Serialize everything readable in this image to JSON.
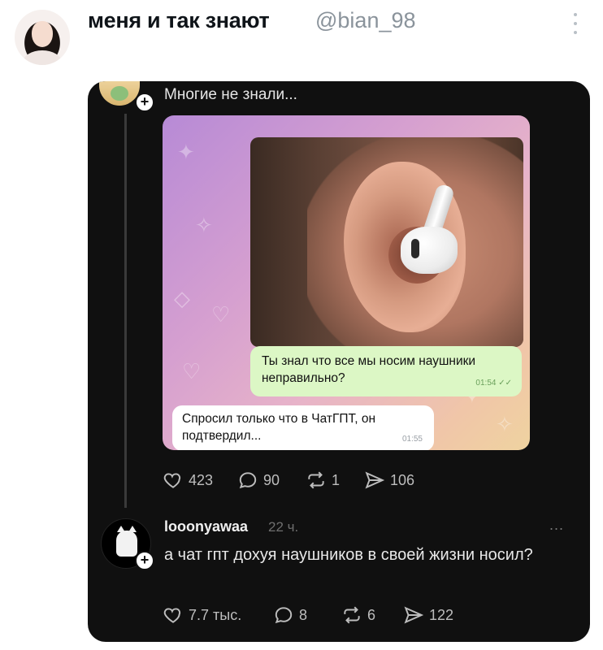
{
  "tweet": {
    "display_name": "меня и так знают",
    "handle": "@bian_98",
    "more_icon": "vertical-dots-icon"
  },
  "post": {
    "text": "Многие не знали...",
    "screenshot": {
      "message_out": "Ты знал что все мы носим наушники неправильно?",
      "message_out_time": "01:54",
      "message_in": "Спросил только что в ЧатГПТ, он подтвердил...",
      "message_in_time": "01:55"
    },
    "stats": {
      "likes": "423",
      "replies": "90",
      "reposts": "1",
      "shares": "106"
    }
  },
  "reply": {
    "username": "looonyawaa",
    "time": "22 ч.",
    "more": "...",
    "text": "а чат гпт дохуя наушников в своей жизни носил?",
    "stats": {
      "likes": "7.7 тыс.",
      "replies": "8",
      "reposts": "6",
      "shares": "122"
    }
  }
}
